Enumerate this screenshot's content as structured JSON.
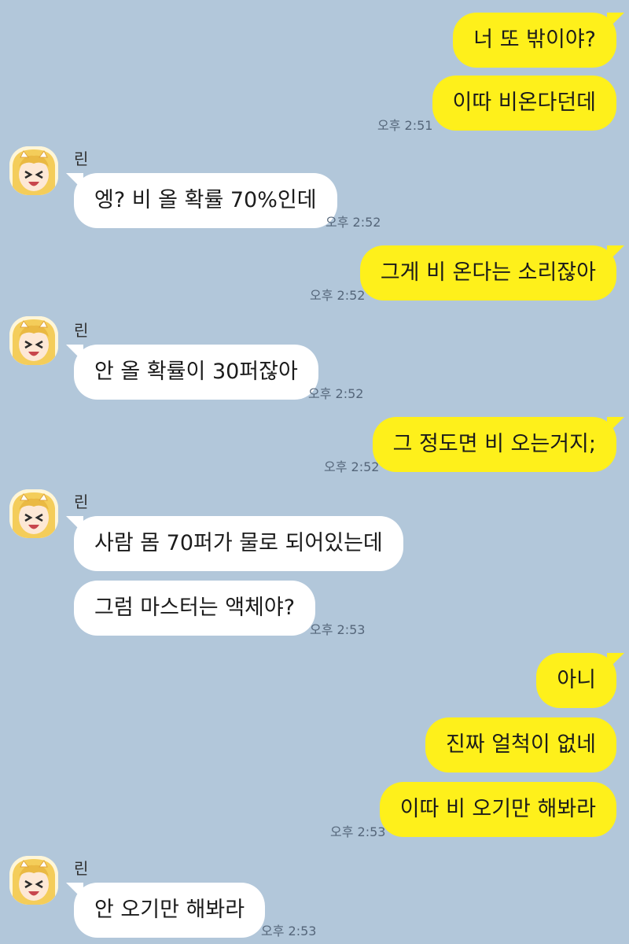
{
  "sender": {
    "name": "린",
    "avatar_icon": "girl-avatar-icon"
  },
  "colors": {
    "background": "#b2c7da",
    "my_bubble": "#fef01b",
    "their_bubble": "#ffffff"
  },
  "messages": [
    {
      "from": "me",
      "text": "너 또 밖이야?"
    },
    {
      "from": "me",
      "text": "이따 비온다던데",
      "time": "오후 2:51"
    },
    {
      "from": "rin",
      "text": "엥? 비 올 확률 70%인데",
      "time": "오후 2:52"
    },
    {
      "from": "me",
      "text": "그게 비 온다는 소리잖아",
      "time": "오후 2:52"
    },
    {
      "from": "rin",
      "text": "안 올 확률이 30퍼잖아",
      "time": "오후 2:52"
    },
    {
      "from": "me",
      "text": "그 정도면 비 오는거지;",
      "time": "오후 2:52"
    },
    {
      "from": "rin",
      "text": "사람 몸 70퍼가 물로 되어있는데"
    },
    {
      "from": "rin",
      "text": "그럼 마스터는 액체야?",
      "time": "오후 2:53"
    },
    {
      "from": "me",
      "text": "아니"
    },
    {
      "from": "me",
      "text": "진짜 얼척이 없네"
    },
    {
      "from": "me",
      "text": "이따 비 오기만 해봐라",
      "time": "오후 2:53"
    },
    {
      "from": "rin",
      "text": "안 오기만 해봐라",
      "time": "오후 2:53"
    }
  ]
}
